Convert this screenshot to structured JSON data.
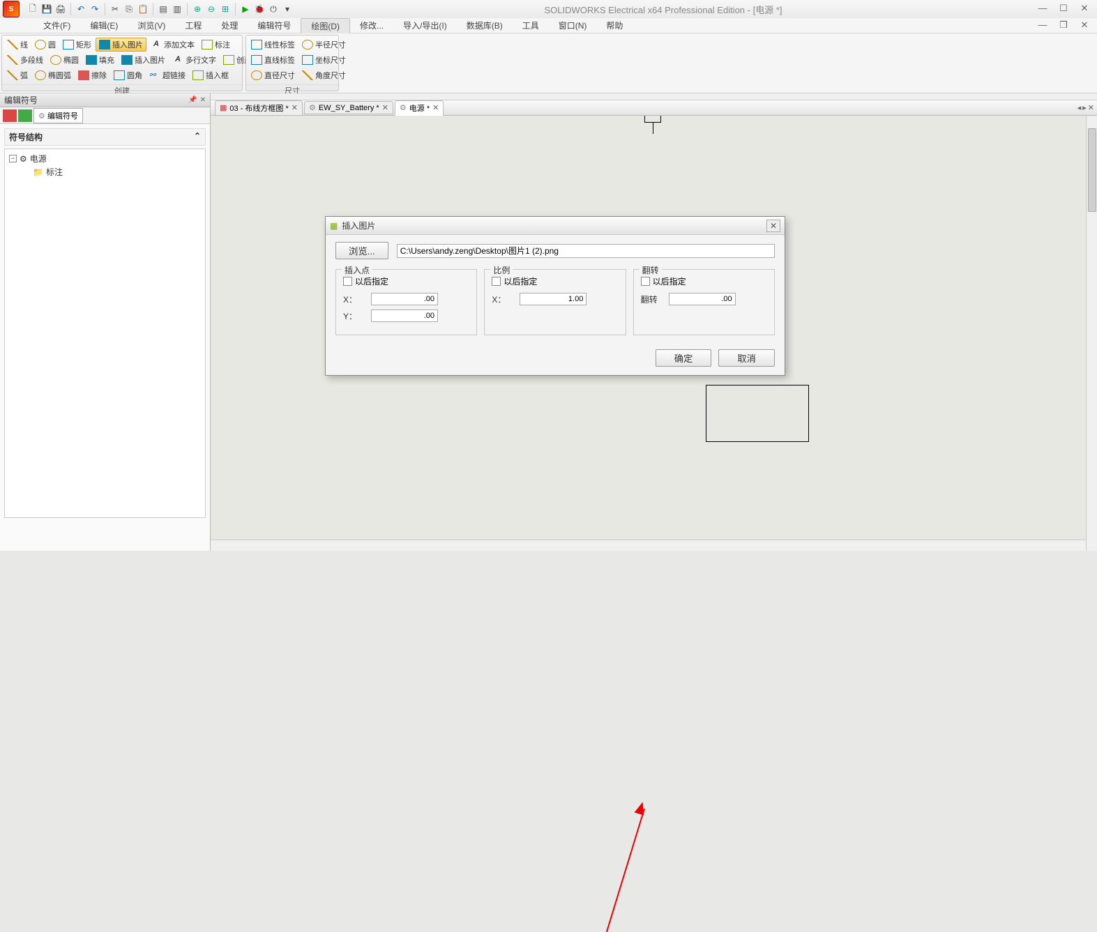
{
  "title": "SOLIDWORKS Electrical x64 Professional Edition - [电源 *]",
  "menubar": {
    "items": [
      "文件(F)",
      "编辑(E)",
      "浏览(V)",
      "工程",
      "处理",
      "编辑符号",
      "绘图(D)",
      "修改...",
      "导入/导出(I)",
      "数据库(B)",
      "工具",
      "窗口(N)",
      "帮助"
    ]
  },
  "ribbon": {
    "group1_title": "创建",
    "group2_title": "尺寸",
    "g1": {
      "r1": [
        "线",
        "圆",
        "矩形",
        "插入图片",
        "添加文本",
        "标注"
      ],
      "r2": [
        "多段线",
        "椭圆",
        "填充",
        "插入图片",
        "多行文字",
        "创建框"
      ],
      "r3": [
        "弧",
        "椭圆弧",
        "擦除",
        "圆角",
        "超链接",
        "插入框"
      ]
    },
    "g2": {
      "r1": [
        "线性标签",
        "半径尺寸"
      ],
      "r2": [
        "直线标签",
        "坐标尺寸"
      ],
      "r3": [
        "直径尺寸",
        "角度尺寸"
      ]
    }
  },
  "left_panel": {
    "title": "编辑符号",
    "tab_label": "编辑符号",
    "section": "符号结构",
    "tree_root": "电源",
    "tree_child": "标注"
  },
  "doc_tabs": [
    {
      "label": "03 - 布线方框图 *"
    },
    {
      "label": "EW_SY_Battery *"
    },
    {
      "label": "电源 *"
    }
  ],
  "dialog": {
    "title": "插入图片",
    "browse": "浏览...",
    "path": "C:\\Users\\andy.zeng\\Desktop\\图片1 (2).png",
    "grp_insert": "插入点",
    "grp_scale": "比例",
    "grp_flip": "翻转",
    "specify_later": "以后指定",
    "x_label": "X：",
    "y_label": "Y：",
    "flip_label": "翻转",
    "x_val": ".00",
    "y_val": ".00",
    "scale_val": "1.00",
    "flip_val": ".00",
    "ok": "确定",
    "cancel": "取消"
  },
  "app_icon_text": "S"
}
